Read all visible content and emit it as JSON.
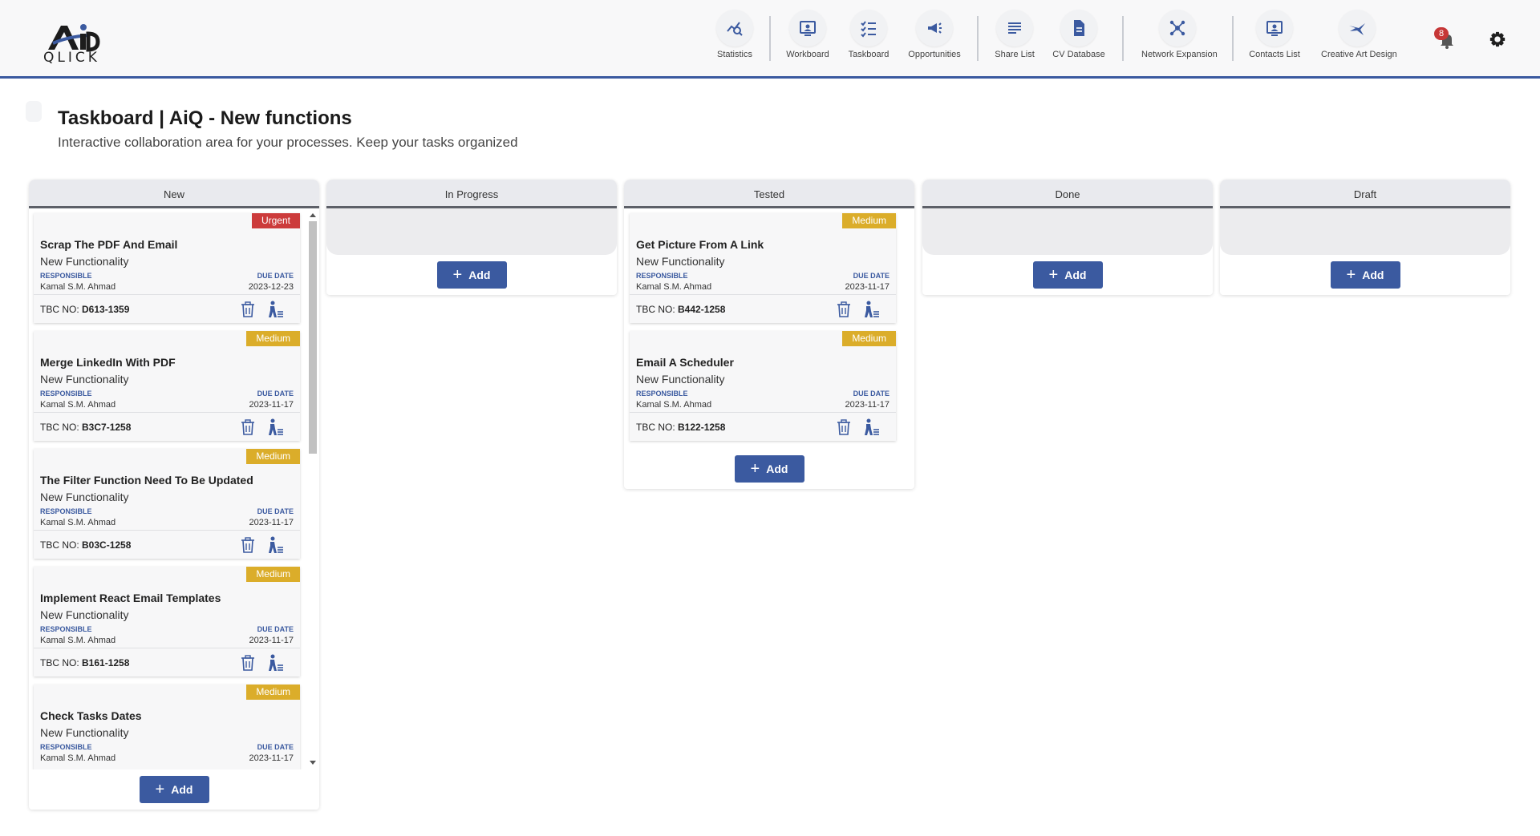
{
  "brand": {
    "logo_text": "QLICK",
    "logo_mark_text": "AiQ"
  },
  "nav": [
    {
      "label": "Statistics",
      "icon": "statistics-icon"
    },
    {
      "label": "Workboard",
      "icon": "workboard-icon"
    },
    {
      "label": "Taskboard",
      "icon": "taskboard-icon"
    },
    {
      "label": "Opportunities",
      "icon": "megaphone-icon"
    },
    {
      "label": "Share List",
      "icon": "list-icon"
    },
    {
      "label": "CV Database",
      "icon": "document-icon"
    },
    {
      "label": "Network Expansion",
      "icon": "network-icon"
    },
    {
      "label": "Contacts List",
      "icon": "contacts-icon"
    },
    {
      "label": "Creative Art Design",
      "icon": "creative-art-logo"
    }
  ],
  "notifications": {
    "count": "8"
  },
  "page": {
    "title": "Taskboard | AiQ - New functions",
    "subtitle": "Interactive collaboration area for your processes. Keep your tasks organized"
  },
  "labels": {
    "responsible": "RESPONSIBLE",
    "due_date": "DUE DATE",
    "tbc_prefix": "TBC NO:",
    "add": "Add"
  },
  "colors": {
    "accent": "#3b5aa0",
    "urgent": "#cc3b3b",
    "medium": "#dbad2a"
  },
  "columns": [
    {
      "title": "New",
      "cards": [
        {
          "priority": "Urgent",
          "title": "Scrap The PDF And Email",
          "type": "New Functionality",
          "responsible": "Kamal S.M. Ahmad",
          "due": "2023-12-23",
          "tbc": "D613-1359"
        },
        {
          "priority": "Medium",
          "title": "Merge LinkedIn With PDF",
          "type": "New Functionality",
          "responsible": "Kamal S.M. Ahmad",
          "due": "2023-11-17",
          "tbc": "B3C7-1258"
        },
        {
          "priority": "Medium",
          "title": "The Filter Function Need To Be Updated",
          "type": "New Functionality",
          "responsible": "Kamal S.M. Ahmad",
          "due": "2023-11-17",
          "tbc": "B03C-1258"
        },
        {
          "priority": "Medium",
          "title": "Implement React Email Templates",
          "type": "New Functionality",
          "responsible": "Kamal S.M. Ahmad",
          "due": "2023-11-17",
          "tbc": "B161-1258"
        },
        {
          "priority": "Medium",
          "title": "Check Tasks Dates",
          "type": "New Functionality",
          "responsible": "Kamal S.M. Ahmad",
          "due": "2023-11-17",
          "tbc": ""
        }
      ]
    },
    {
      "title": "In Progress",
      "cards": []
    },
    {
      "title": "Tested",
      "cards": [
        {
          "priority": "Medium",
          "title": "Get Picture From A Link",
          "type": "New Functionality",
          "responsible": "Kamal S.M. Ahmad",
          "due": "2023-11-17",
          "tbc": "B442-1258"
        },
        {
          "priority": "Medium",
          "title": "Email A Scheduler",
          "type": "New Functionality",
          "responsible": "Kamal S.M. Ahmad",
          "due": "2023-11-17",
          "tbc": "B122-1258"
        }
      ]
    },
    {
      "title": "Done",
      "cards": []
    },
    {
      "title": "Draft",
      "cards": []
    }
  ]
}
